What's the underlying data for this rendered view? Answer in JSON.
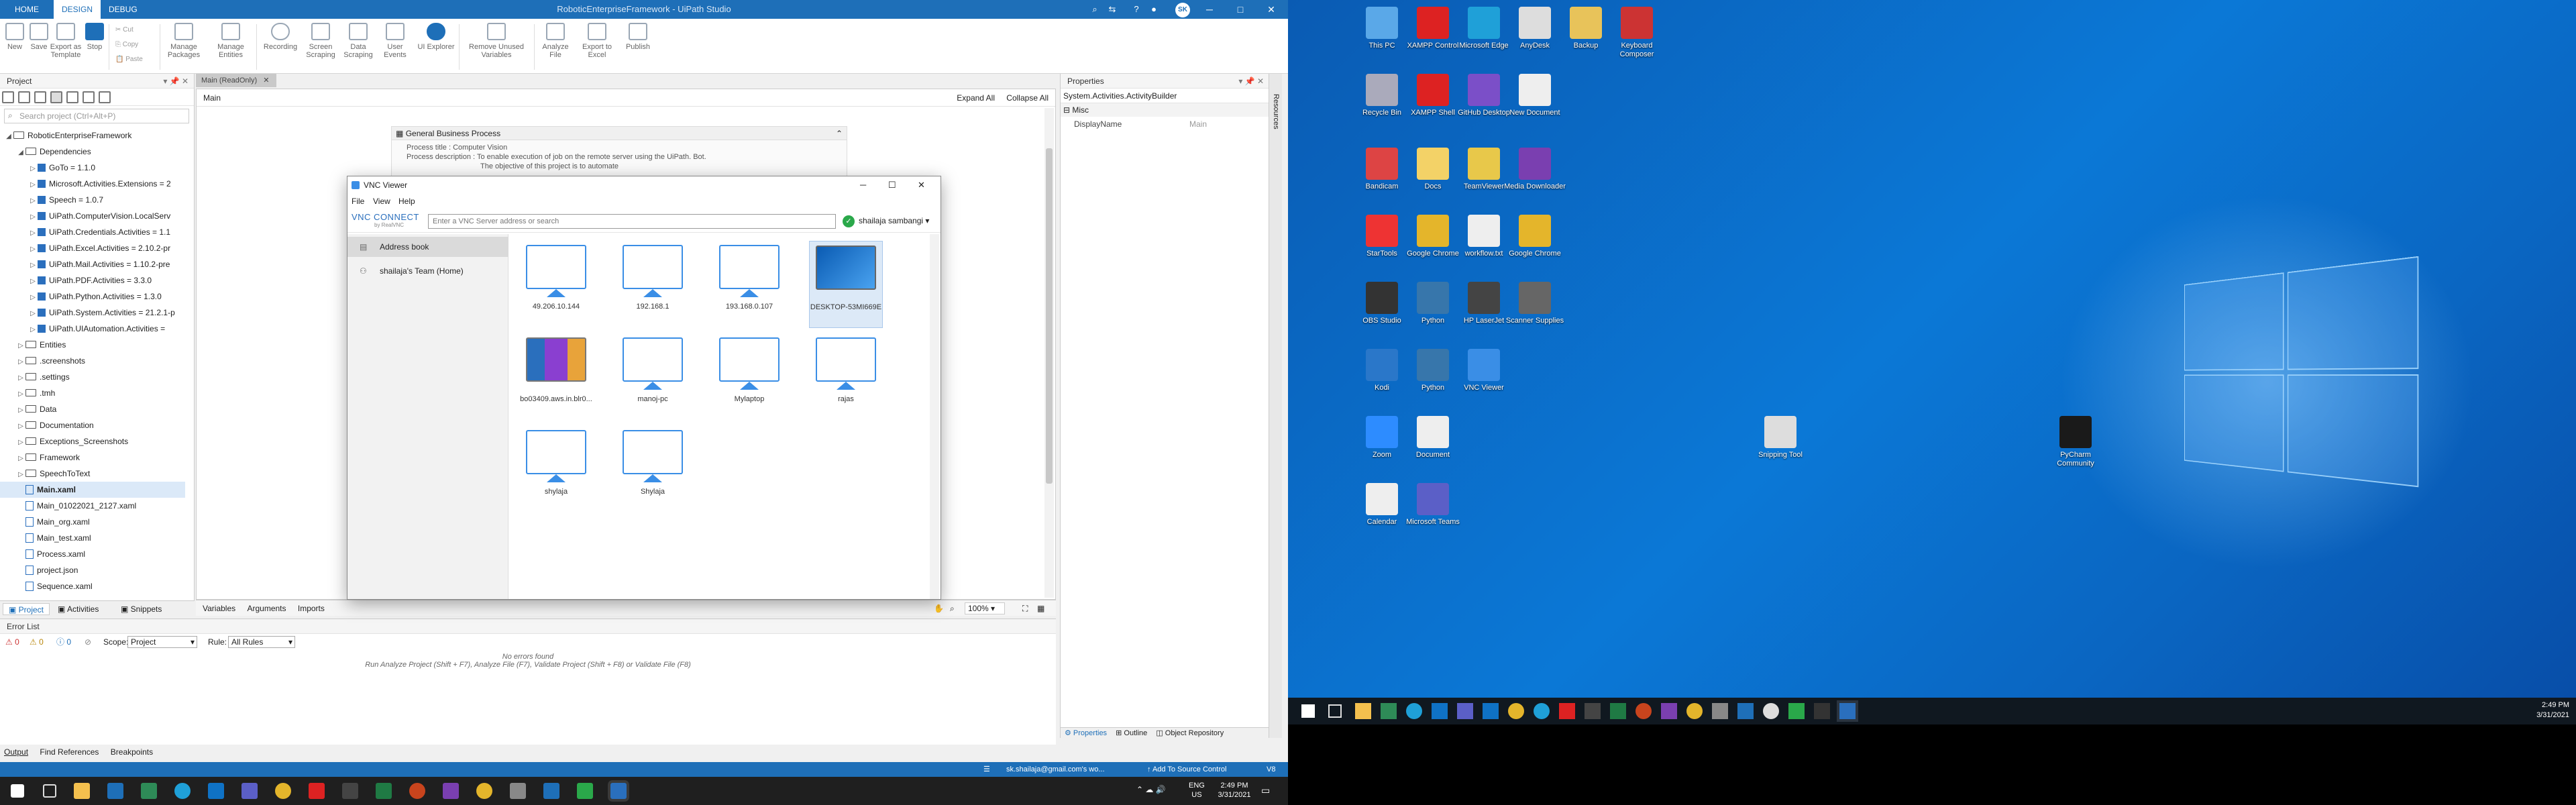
{
  "studio": {
    "tabs": {
      "home": "HOME",
      "design": "DESIGN",
      "debug": "DEBUG"
    },
    "window_title": "RoboticEnterpriseFramework - UiPath Studio",
    "user_badge": "SK",
    "ribbon": [
      {
        "label": "New",
        "icon": "new-icon"
      },
      {
        "label": "Save",
        "icon": "save-icon"
      },
      {
        "label": "Export as Template",
        "icon": "export-template-icon"
      },
      {
        "label": "Stop",
        "icon": "stop-icon"
      },
      {
        "label": "Cut",
        "icon": "cut-icon"
      },
      {
        "label": "Copy",
        "icon": "copy-icon"
      },
      {
        "label": "Paste",
        "icon": "paste-icon"
      },
      {
        "label": "Manage Packages",
        "icon": "packages-icon"
      },
      {
        "label": "Manage Entities",
        "icon": "entities-icon"
      },
      {
        "label": "Recording",
        "icon": "recording-icon"
      },
      {
        "label": "Screen Scraping",
        "icon": "screen-scraping-icon"
      },
      {
        "label": "Data Scraping",
        "icon": "data-scraping-icon"
      },
      {
        "label": "User Events",
        "icon": "user-events-icon"
      },
      {
        "label": "UI Explorer",
        "icon": "ui-explorer-icon"
      },
      {
        "label": "Remove Unused Variables",
        "icon": "remove-variables-icon"
      },
      {
        "label": "Analyze File",
        "icon": "analyze-icon"
      },
      {
        "label": "Export to Excel",
        "icon": "excel-icon"
      },
      {
        "label": "Publish",
        "icon": "publish-icon"
      }
    ],
    "project_panel": {
      "title": "Project",
      "search_placeholder": "Search project (Ctrl+Alt+P)",
      "tree": [
        {
          "label": "RoboticEnterpriseFramework",
          "level": 0,
          "kind": "project"
        },
        {
          "label": "Dependencies",
          "level": 1,
          "kind": "folder"
        },
        {
          "label": "GoTo = 1.1.0",
          "level": 2,
          "kind": "pkg"
        },
        {
          "label": "Microsoft.Activities.Extensions = 2",
          "level": 2,
          "kind": "pkg"
        },
        {
          "label": "Speech = 1.0.7",
          "level": 2,
          "kind": "pkg"
        },
        {
          "label": "UiPath.ComputerVision.LocalServ",
          "level": 2,
          "kind": "pkg"
        },
        {
          "label": "UiPath.Credentials.Activities = 1.1",
          "level": 2,
          "kind": "pkg"
        },
        {
          "label": "UiPath.Excel.Activities = 2.10.2-pr",
          "level": 2,
          "kind": "pkg"
        },
        {
          "label": "UiPath.Mail.Activities = 1.10.2-pre",
          "level": 2,
          "kind": "pkg"
        },
        {
          "label": "UiPath.PDF.Activities = 3.3.0",
          "level": 2,
          "kind": "pkg"
        },
        {
          "label": "UiPath.Python.Activities = 1.3.0",
          "level": 2,
          "kind": "pkg"
        },
        {
          "label": "UiPath.System.Activities = 21.2.1-p",
          "level": 2,
          "kind": "pkg"
        },
        {
          "label": "UiPath.UIAutomation.Activities =",
          "level": 2,
          "kind": "pkg"
        },
        {
          "label": "Entities",
          "level": 1,
          "kind": "folder"
        },
        {
          "label": ".screenshots",
          "level": 1,
          "kind": "folder"
        },
        {
          "label": ".settings",
          "level": 1,
          "kind": "folder"
        },
        {
          "label": ".tmh",
          "level": 1,
          "kind": "folder"
        },
        {
          "label": "Data",
          "level": 1,
          "kind": "folder"
        },
        {
          "label": "Documentation",
          "level": 1,
          "kind": "folder"
        },
        {
          "label": "Exceptions_Screenshots",
          "level": 1,
          "kind": "folder"
        },
        {
          "label": "Framework",
          "level": 1,
          "kind": "folder"
        },
        {
          "label": "SpeechToText",
          "level": 1,
          "kind": "folder"
        },
        {
          "label": "Main.xaml",
          "level": 1,
          "kind": "xaml",
          "selected": true
        },
        {
          "label": "Main_01022021_2127.xaml",
          "level": 1,
          "kind": "xaml"
        },
        {
          "label": "Main_org.xaml",
          "level": 1,
          "kind": "xaml"
        },
        {
          "label": "Main_test.xaml",
          "level": 1,
          "kind": "xaml"
        },
        {
          "label": "Process.xaml",
          "level": 1,
          "kind": "xaml"
        },
        {
          "label": "project.json",
          "level": 1,
          "kind": "xaml"
        },
        {
          "label": "Sequence.xaml",
          "level": 1,
          "kind": "xaml"
        }
      ],
      "bottom_tabs": [
        "Project",
        "Activities",
        "Snippets"
      ]
    },
    "designer": {
      "doc_tab": "Main (ReadOnly)",
      "breadcrumb": "Main",
      "expand_all": "Expand All",
      "collapse_all": "Collapse All",
      "gbp_title": "General Business Process",
      "gbp_line1": "Process title : Computer Vision",
      "gbp_line2": "Process description : To enable execution of job on the remote server using the UiPath. Bot.",
      "gbp_line3": "The objective of this project is to automate",
      "bottom": {
        "variables": "Variables",
        "arguments": "Arguments",
        "imports": "Imports",
        "zoom": "100%"
      }
    },
    "properties": {
      "title": "Properties",
      "type": "System.Activities.ActivityBuilder",
      "category": "Misc",
      "field_name": "DisplayName",
      "field_value": "Main",
      "side_tab": "Resources",
      "bottom_tabs": [
        "Properties",
        "Outline",
        "Object Repository"
      ]
    },
    "error_list": {
      "title": "Error List",
      "err_count": "0",
      "warn_count": "0",
      "info_count": "0",
      "scope_label": "Scope:",
      "scope_value": "Project",
      "rule_label": "Rule:",
      "rule_value": "All Rules",
      "empty_msg": "No errors found",
      "hint": "Run Analyze Project (Shift + F7), Analyze File (F7), Validate Project (Shift + F8) or Validate File (F8)"
    },
    "output_tabs": [
      "Output",
      "Find References",
      "Breakpoints"
    ],
    "status": {
      "account": "sk.shailaja@gmail.com's wo...",
      "source_control": "Add To Source Control",
      "version": "V8"
    }
  },
  "vnc": {
    "title": "VNC Viewer",
    "menu": [
      "File",
      "View",
      "Help"
    ],
    "brand": "VNC CONNECT",
    "brand_sub": "by RealVNC",
    "address_placeholder": "Enter a VNC Server address or search",
    "account": "shailaja sambangi",
    "sidebar": [
      "Address book",
      "shailaja's Team (Home)"
    ],
    "computers": [
      {
        "label": "49.206.10.144",
        "preview": "blank"
      },
      {
        "label": "192.168.1",
        "preview": "blank"
      },
      {
        "label": "193.168.0.107",
        "preview": "blank"
      },
      {
        "label": "DESKTOP-53MI669E",
        "preview": "desktop",
        "selected": true
      },
      {
        "label": "bo03409.aws.in.blr0...",
        "preview": "colorful"
      },
      {
        "label": "manoj-pc",
        "preview": "blank"
      },
      {
        "label": "Mylaptop",
        "preview": "blank"
      },
      {
        "label": "rajas",
        "preview": "blank"
      },
      {
        "label": "shylaja",
        "preview": "blank"
      },
      {
        "label": "Shylaja",
        "preview": "blank"
      }
    ]
  },
  "desktop": {
    "icons": [
      {
        "label": "This PC",
        "color": "#5aa8e8"
      },
      {
        "label": "XAMPP Control",
        "color": "#d22"
      },
      {
        "label": "Microsoft Edge",
        "color": "#1fa0d8"
      },
      {
        "label": "AnyDesk",
        "color": "#ddd"
      },
      {
        "label": "Backup",
        "color": "#e8c35a"
      },
      {
        "label": "Keyboard Composer",
        "color": "#c33"
      },
      {
        "label": "Recycle Bin",
        "color": "#aab"
      },
      {
        "label": "XAMPP Shell",
        "color": "#d22"
      },
      {
        "label": "GitHub Desktop",
        "color": "#7b4fc8"
      },
      {
        "label": "New Document",
        "color": "#eee"
      },
      {
        "label": "Bandicam",
        "color": "#d44"
      },
      {
        "label": "Docs",
        "color": "#f3d267"
      },
      {
        "label": "TeamViewer",
        "color": "#e8c84a"
      },
      {
        "label": "Media Downloader",
        "color": "#7a3fb0"
      },
      {
        "label": "StarTools",
        "color": "#e33"
      },
      {
        "label": "Google Chrome",
        "color": "#e4b52b"
      },
      {
        "label": "workflow.txt",
        "color": "#eee"
      },
      {
        "label": "Google Chrome",
        "color": "#e4b52b"
      },
      {
        "label": "OBS Studio",
        "color": "#333"
      },
      {
        "label": "Python",
        "color": "#3776ab"
      },
      {
        "label": "HP LaserJet",
        "color": "#444"
      },
      {
        "label": "Scanner Supplies",
        "color": "#666"
      },
      {
        "label": "Kodi",
        "color": "#2a77c9"
      },
      {
        "label": "Python",
        "color": "#3776ab"
      },
      {
        "label": "VNC Viewer",
        "color": "#3a8ee6"
      },
      {
        "label": "Zoom",
        "color": "#2d8cff"
      },
      {
        "label": "Document",
        "color": "#eee"
      },
      {
        "label": "Snipping Tool",
        "color": "#ddd"
      },
      {
        "label": "PyCharm Community",
        "color": "#1a1a1a"
      },
      {
        "label": "Calendar",
        "color": "#eee"
      },
      {
        "label": "Microsoft Teams",
        "color": "#5b5fc7"
      }
    ],
    "clock_time": "2:49 PM",
    "clock_date": "3/31/2021"
  },
  "taskbar": {
    "tray_lang": "ENG",
    "tray_region": "US",
    "time": "2:49 PM",
    "date": "3/31/2021"
  }
}
